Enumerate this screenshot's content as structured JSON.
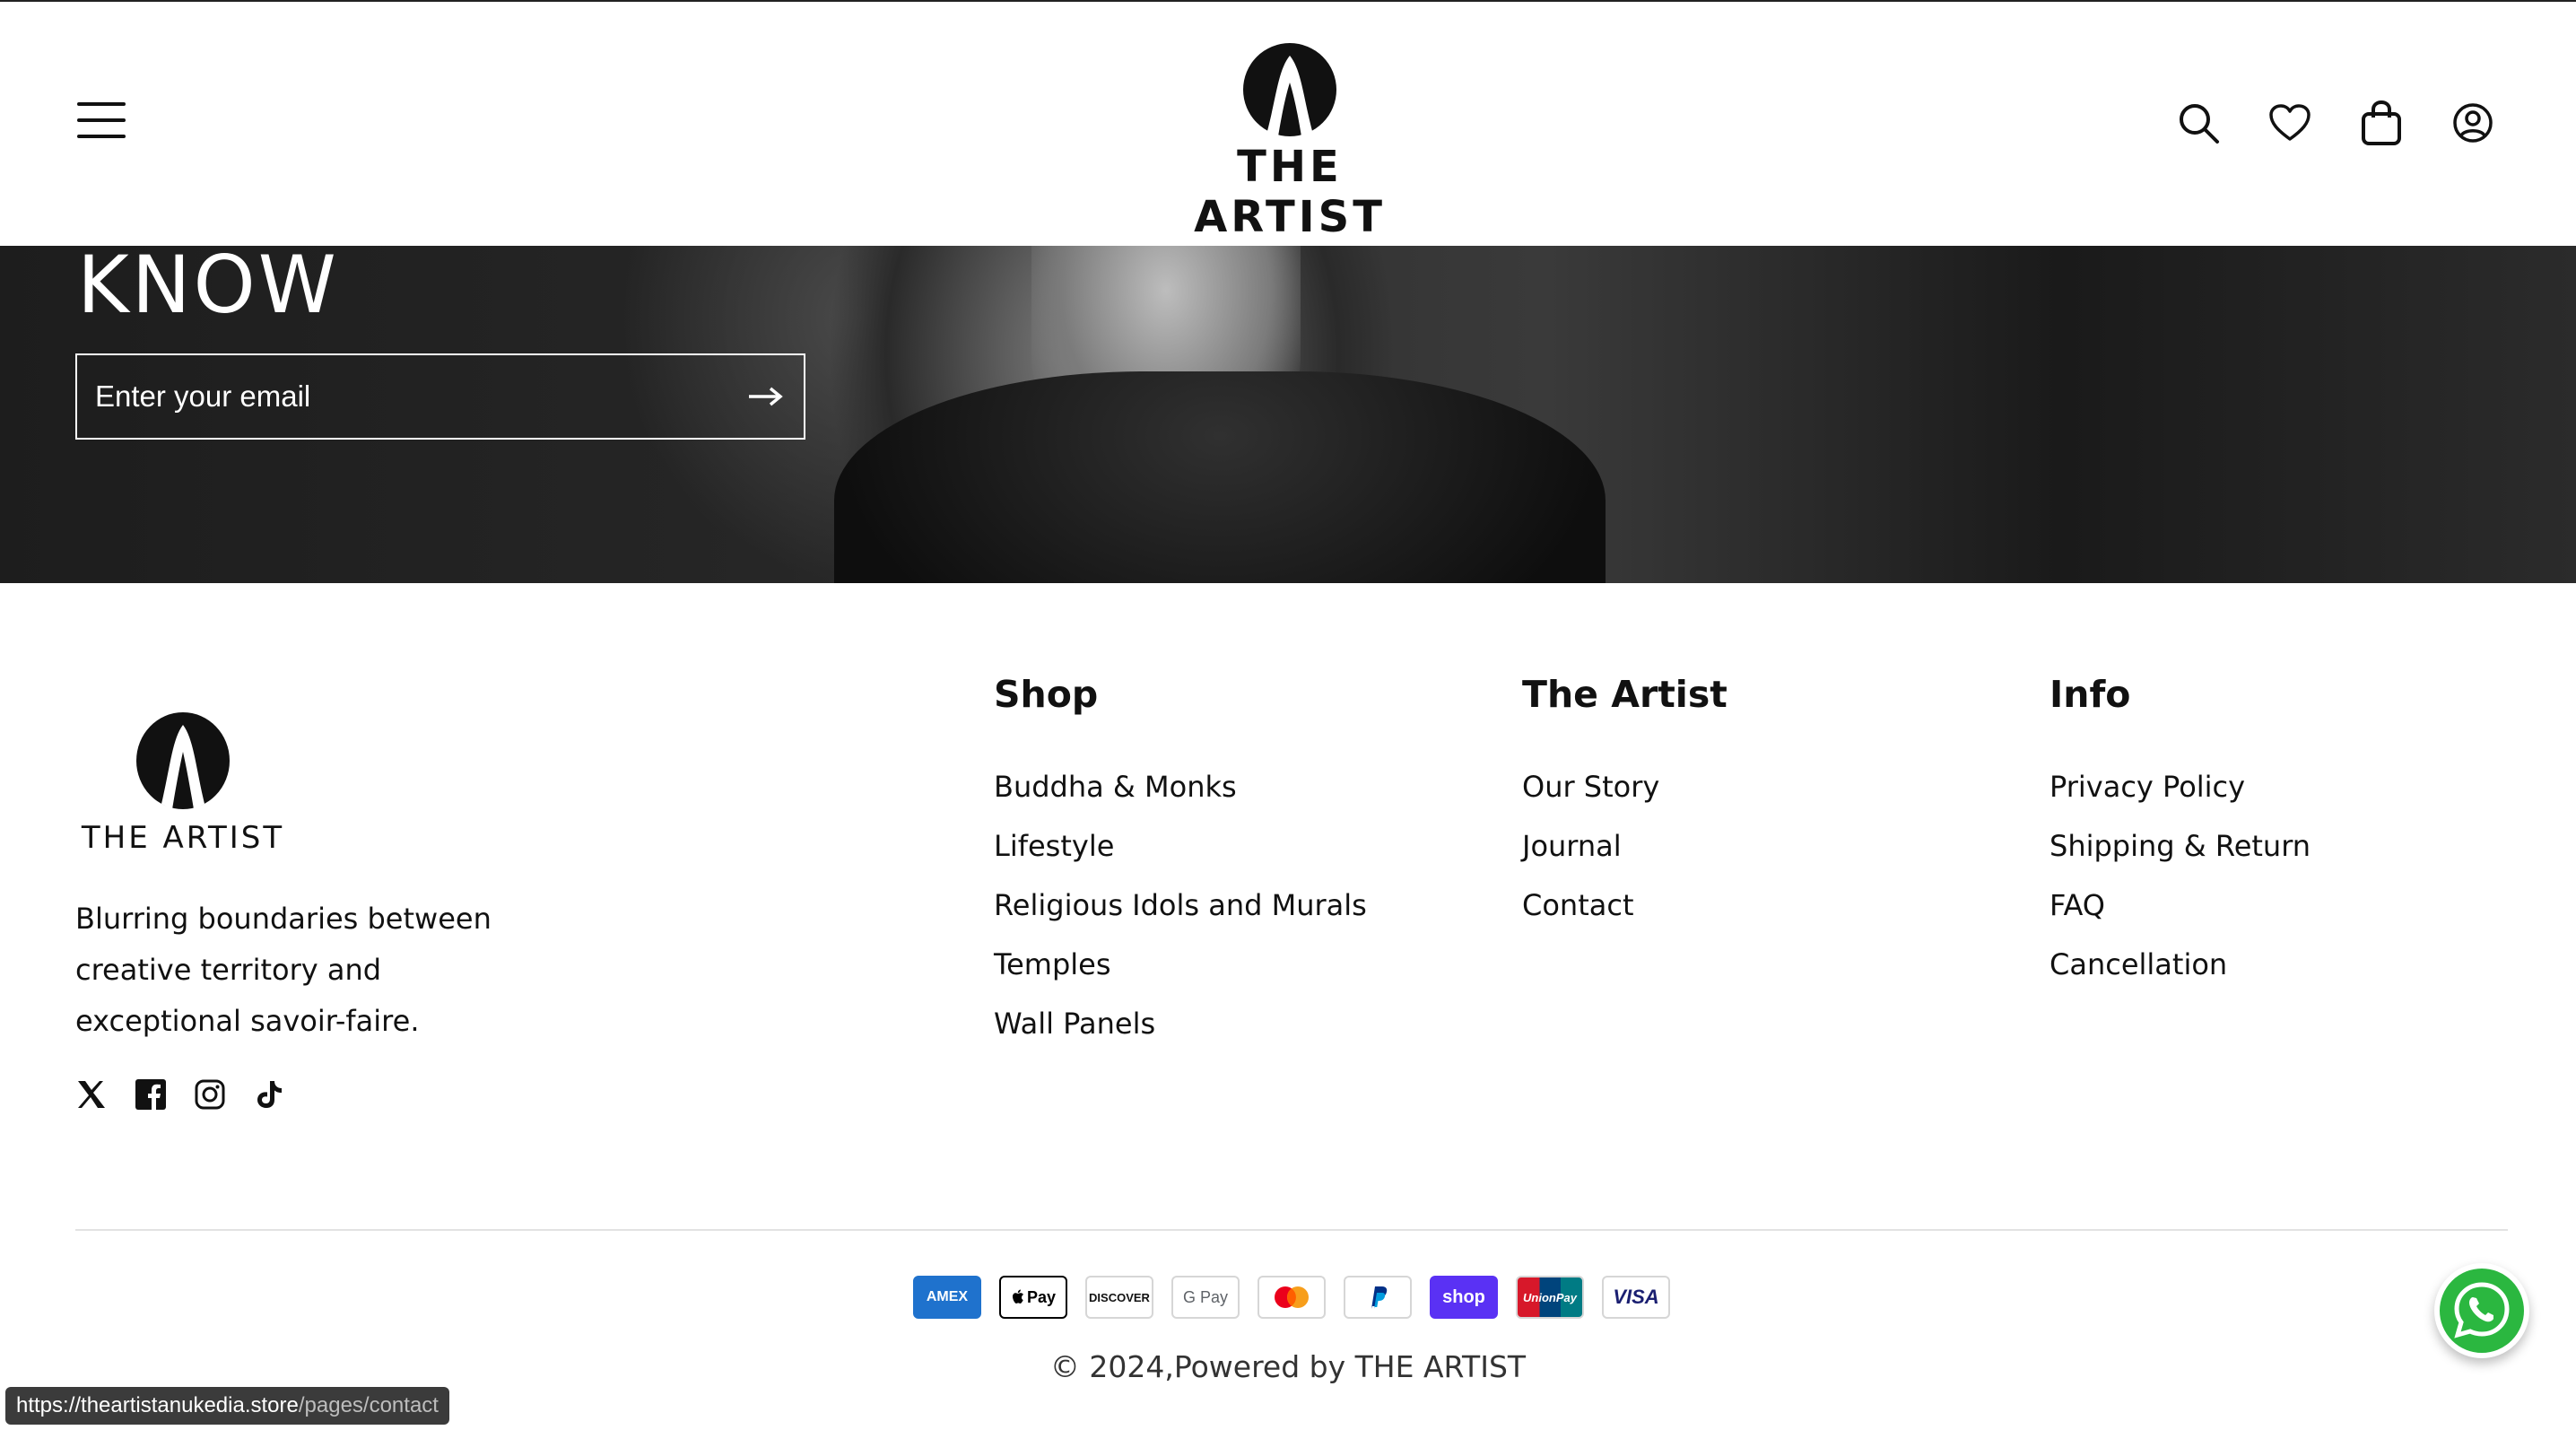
{
  "header": {
    "brand_name": "THE ARTIST",
    "icons": [
      "menu-icon",
      "search-icon",
      "heart-icon",
      "bag-icon",
      "account-icon"
    ]
  },
  "hero": {
    "title": "KNOW",
    "email_placeholder": "Enter your email"
  },
  "footer": {
    "brand_name": "THE ARTIST",
    "tagline": "Blurring boundaries between creative territory and exceptional savoir-faire.",
    "social": [
      "x-icon",
      "facebook-icon",
      "instagram-icon",
      "tiktok-icon"
    ],
    "columns": {
      "shop": {
        "title": "Shop",
        "items": [
          "Buddha & Monks",
          "Lifestyle",
          "Religious Idols and Murals",
          "Temples",
          "Wall Panels"
        ]
      },
      "artist": {
        "title": "The Artist",
        "items": [
          "Our Story",
          "Journal",
          "Contact"
        ]
      },
      "info": {
        "title": "Info",
        "items": [
          "Privacy Policy",
          "Shipping & Return",
          "FAQ",
          "Cancellation"
        ]
      }
    },
    "payments": [
      "AMEX",
      "Pay",
      "DISCOVER",
      "G Pay",
      "Mastercard",
      "PayPal",
      "shop",
      "UnionPay",
      "VISA"
    ],
    "copyright": "© 2024,Powered by THE ARTIST"
  },
  "status": {
    "url_host": "https://theartistanukedia.store",
    "url_path": "/pages/contact"
  },
  "colors": {
    "accent": "#111111",
    "shop_pay": "#5a31f4",
    "whatsapp": "#2bb740"
  }
}
